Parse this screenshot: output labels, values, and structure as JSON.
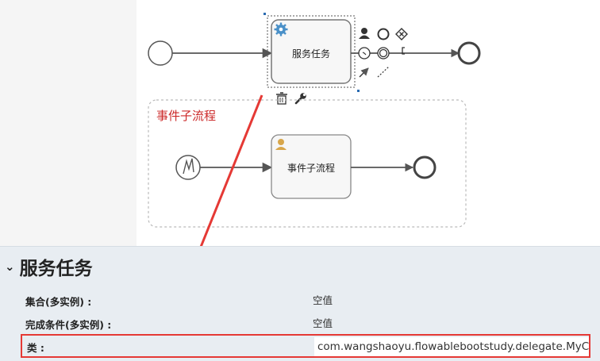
{
  "diagram": {
    "service_task_label": "服务任务",
    "subprocess_title": "事件子流程",
    "subprocess_task_label": "事件子流程",
    "palette": {
      "user_icon": "user-icon",
      "end_event_icon": "circle-icon",
      "gateway_icon": "gateway-icon",
      "intermediate_icon": "timer-icon",
      "intermediate_event_icon": "double-circle-icon",
      "text_annotation_icon": "annotation-icon",
      "flow_icon": "arrow-icon",
      "association_icon": "dotted-line-icon",
      "delete_icon": "trash-icon",
      "settings_icon": "wrench-icon"
    }
  },
  "properties": {
    "section_title": "服务任务",
    "rows": [
      {
        "key": "集合(多实例) :",
        "value": "空值"
      },
      {
        "key": "完成条件(多实例) :",
        "value": "空值"
      },
      {
        "key": "类 :",
        "value": "com.wangshaoyu.flowablebootstudy.delegate.MyC"
      }
    ]
  },
  "colors": {
    "highlight": "#e53935",
    "subprocess_title": "#cc2a2a",
    "panel_bg": "#e8edf2"
  }
}
